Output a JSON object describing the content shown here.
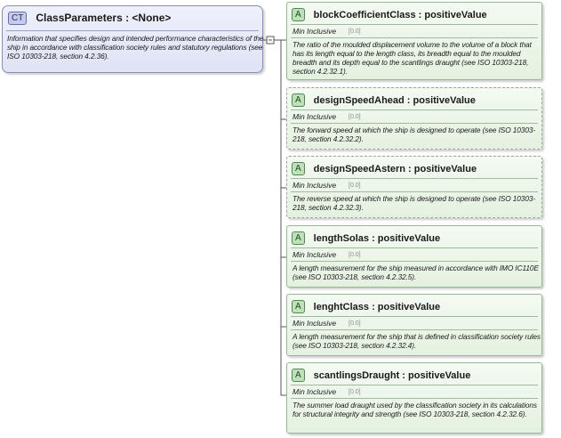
{
  "complex_type": {
    "badge": "CT",
    "title": "ClassParameters   : <None>",
    "description": "Information that specifies design and intended performance characteristics of the ship in accordance with classification society rules and statutory regulations (see ISO 10303-218, section 4.2.36)."
  },
  "attributes": [
    {
      "badge": "A",
      "title": "blockCoefficientClass   : positiveValue",
      "facet_name": "Min Inclusive",
      "facet_value": "[0.0]",
      "description": "The ratio of the moulded displacement volume to the volume of a block that has its length equal to the length class, its breadth equal to the moulded breadth and its depth equal to the scantlings draught (see ISO 10303-218, section 4.2.32.1).",
      "optional": false
    },
    {
      "badge": "A",
      "title": "designSpeedAhead   : positiveValue",
      "facet_name": "Min Inclusive",
      "facet_value": "[0.0]",
      "description": "The forward speed at which the ship is designed to operate (see ISO 10303-218, section 4.2.32.2).",
      "optional": true
    },
    {
      "badge": "A",
      "title": "designSpeedAstern   : positiveValue",
      "facet_name": "Min Inclusive",
      "facet_value": "[0.0]",
      "description": "The reverse speed at which the ship is designed to operate (see ISO 10303-218, section 4.2.32.3).",
      "optional": true
    },
    {
      "badge": "A",
      "title": "lengthSolas   : positiveValue",
      "facet_name": "Min Inclusive",
      "facet_value": "[0.0]",
      "description": "A length measurement for the ship measured in accordance with IMO IC110E (see ISO 10303-218, section 4.2.32.5).",
      "optional": false
    },
    {
      "badge": "A",
      "title": "lenghtClass   : positiveValue",
      "facet_name": "Min Inclusive",
      "facet_value": "[0.0]",
      "description": "A length measurement for the ship that is defined in classification society rules (see ISO 10303-218, section 4.2.32.4).",
      "optional": false
    },
    {
      "badge": "A",
      "title": "scantlingsDraught   : positiveValue",
      "facet_name": "Min Inclusive",
      "facet_value": "[0.0]",
      "description": "The summer load draught used by the classification society in its calculations for structural integrity and strength (see ISO 10303-218, section 4.2.32.6).",
      "optional": false
    }
  ]
}
